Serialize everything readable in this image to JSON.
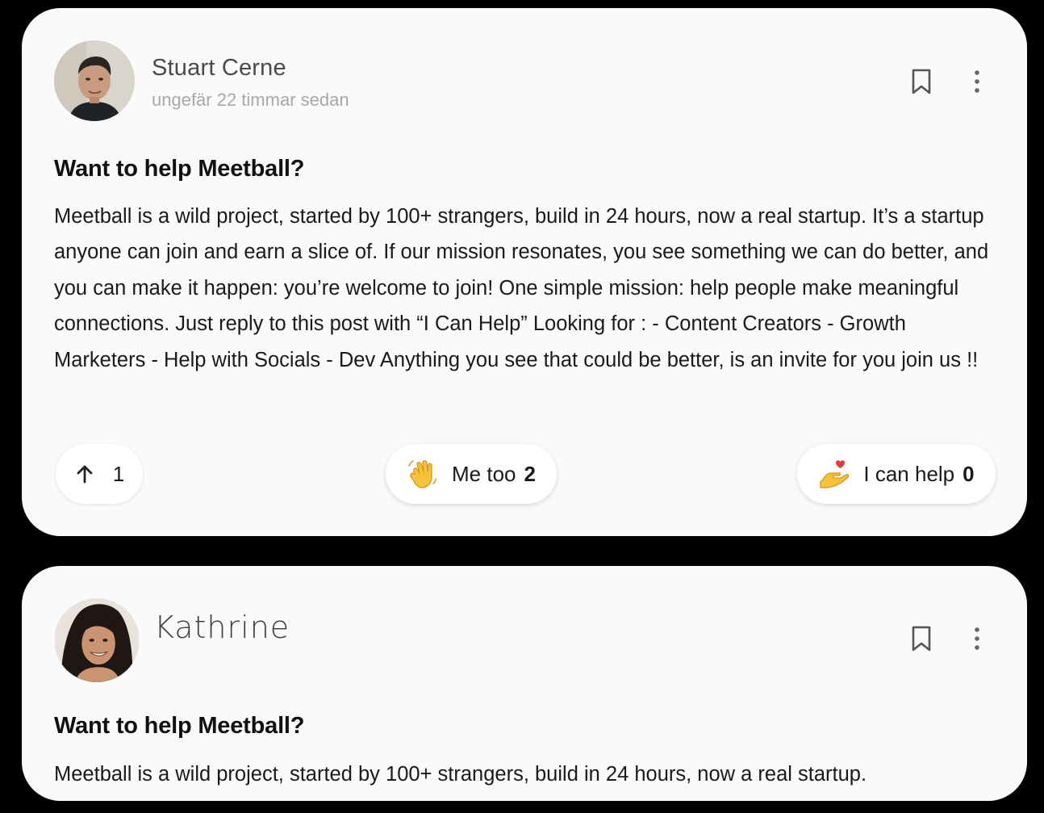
{
  "posts": [
    {
      "author": "Stuart Cerne",
      "timestamp": "ungefär 22 timmar sedan",
      "title": "Want to help Meetball?",
      "body": "Meetball is a wild project, started by 100+ strangers, build in 24 hours, now a real startup. It’s a startup anyone can join and earn a slice of. If our mission resonates, you see something we can do better, and you can make it happen: you’re welcome to join! One simple mission: help people make meaningful connections. Just reply to this post with “I Can Help” Looking for : - Content Creators - Growth Marketers - Help with Socials - Dev Anything you see that could be better, is an invite for you join us !!",
      "upvotes": "1",
      "me_too_label": "Me too",
      "me_too_count": "2",
      "can_help_label": "I can help",
      "can_help_count": "0"
    },
    {
      "author": "Kathrine",
      "title": "Want to help Meetball?",
      "body": "Meetball is a wild project, started by 100+ strangers, build in 24 hours, now a real startup."
    }
  ],
  "icons": {
    "bookmark": "bookmark-icon",
    "more": "more-vertical-icon",
    "upvote": "arrow-up-icon",
    "me_too": "waving-hand-icon",
    "can_help": "heart-on-hand-icon"
  }
}
